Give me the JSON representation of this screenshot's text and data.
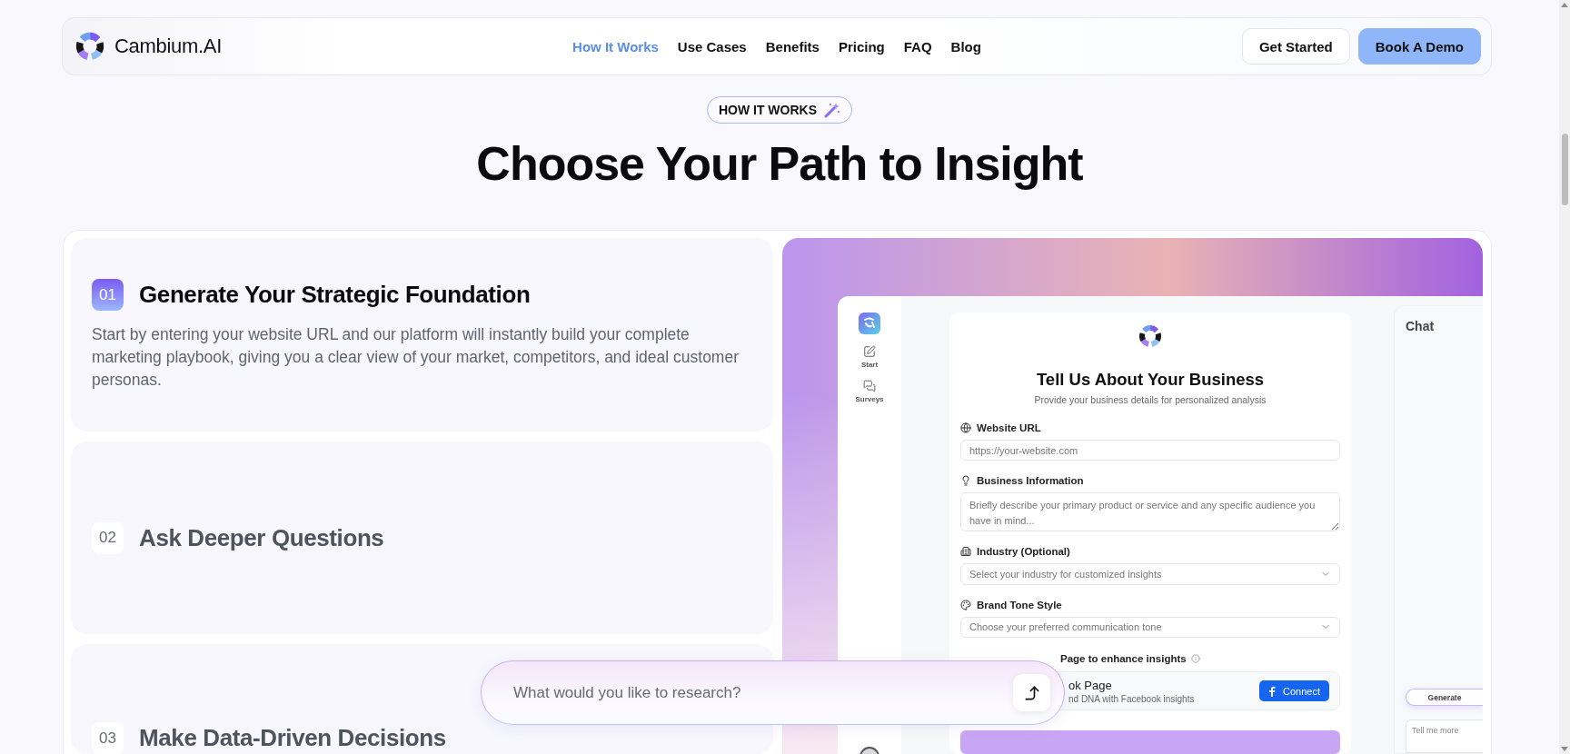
{
  "header": {
    "brand": "Cambium.AI",
    "nav": [
      {
        "label": "How It Works",
        "selected": true
      },
      {
        "label": "Use Cases",
        "selected": false
      },
      {
        "label": "Benefits",
        "selected": false
      },
      {
        "label": "Pricing",
        "selected": false
      },
      {
        "label": "FAQ",
        "selected": false
      },
      {
        "label": "Blog",
        "selected": false
      }
    ],
    "buttons": [
      {
        "label": "Get Started",
        "kind": "outline"
      },
      {
        "label": "Book A Demo",
        "kind": "primary"
      }
    ]
  },
  "section": {
    "badge": "HOW IT WORKS",
    "title": "Choose Your Path to Insight"
  },
  "steps": [
    {
      "number": "01",
      "title": "Generate Your Strategic Foundation",
      "description": "Start by entering your website URL and our platform will instantly build your complete marketing playbook, giving you a clear view of your market, competitors, and ideal customer personas.",
      "selected": true
    },
    {
      "number": "02",
      "title": "Ask Deeper Questions",
      "selected": false
    },
    {
      "number": "03",
      "title": "Make Data-Driven Decisions",
      "selected": false
    }
  ],
  "preview": {
    "sidebar": [
      {
        "label": "Start"
      },
      {
        "label": "Surveys"
      }
    ],
    "form": {
      "title": "Tell Us About Your Business",
      "subtitle": "Provide your business details for personalized analysis",
      "fields": [
        {
          "kind": "text",
          "label": "Website URL",
          "placeholder": "https://your-website.com"
        },
        {
          "kind": "textarea",
          "label": "Business Information",
          "placeholder": "Briefly describe your primary product or service and any specific audience you have in mind..."
        },
        {
          "kind": "select",
          "label": "Industry (Optional)",
          "placeholder": "Select your industry for customized insights"
        },
        {
          "kind": "select",
          "label": "Brand Tone Style",
          "placeholder": "Choose your preferred communication tone"
        }
      ],
      "facebook": {
        "label": "Page to enhance insights",
        "card_title": "ok Page",
        "card_subtitle": "nd DNA with Facebook insights",
        "button": "Connect"
      }
    },
    "chat": {
      "title": "Chat",
      "button": "Generate",
      "placeholder": "Tell me more"
    }
  },
  "prompt": {
    "placeholder": "What would you like to research?"
  }
}
